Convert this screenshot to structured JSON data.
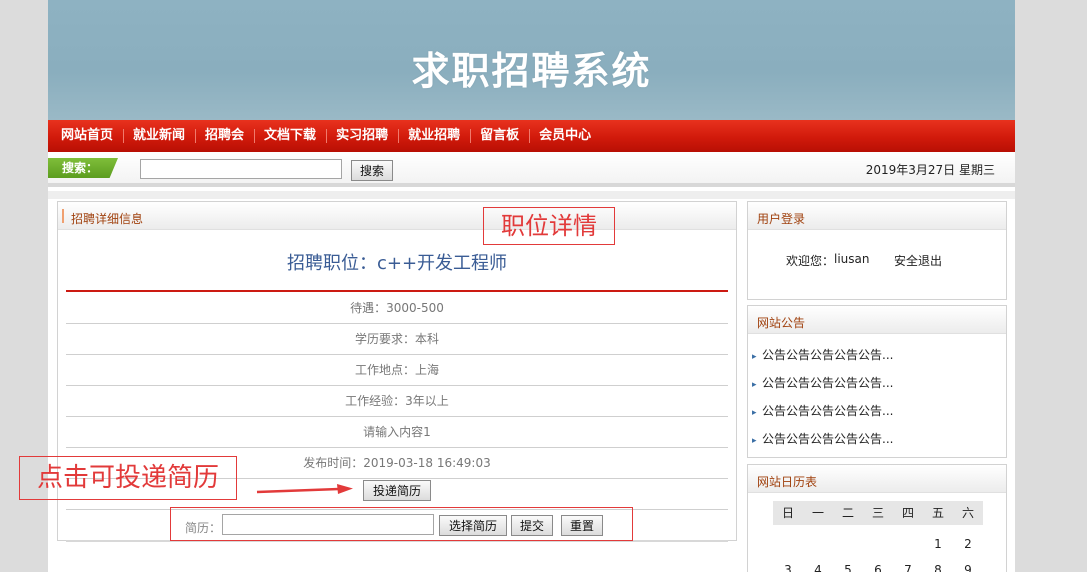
{
  "site": {
    "title": "求职招聘系统"
  },
  "nav": {
    "items": [
      "网站首页",
      "就业新闻",
      "招聘会",
      "文档下载",
      "实习招聘",
      "就业招聘",
      "留言板",
      "会员中心"
    ]
  },
  "search": {
    "label": "搜索：",
    "placeholder": "",
    "value": "",
    "button": "搜索"
  },
  "date": "2019年3月27日 星期三",
  "main": {
    "section_title": "招聘详细信息",
    "job_title": "招聘职位：c++开发工程师",
    "details": [
      "待遇：3000-500",
      "学历要求：本科",
      "工作地点：上海",
      "工作经验：3年以上",
      "请输入内容1",
      "发布时间：2019-03-18 16:49:03"
    ],
    "apply_button": "投递简历",
    "resume_label": "简历：",
    "resume_value": "",
    "choose_button": "选择简历",
    "submit_button": "提交",
    "reset_button": "重置"
  },
  "login": {
    "title": "用户登录",
    "welcome": "欢迎您：",
    "username": "liusan",
    "logout": "安全退出"
  },
  "notice": {
    "title": "网站公告",
    "items": [
      "公告公告公告公告公告...",
      "公告公告公告公告公告...",
      "公告公告公告公告公告...",
      "公告公告公告公告公告..."
    ]
  },
  "calendar": {
    "title": "网站日历表",
    "weekdays": [
      "日",
      "一",
      "二",
      "三",
      "四",
      "五",
      "六"
    ],
    "rows": [
      [
        "",
        "",
        "",
        "",
        "",
        "1",
        "2"
      ],
      [
        "3",
        "4",
        "5",
        "6",
        "7",
        "8",
        "9"
      ]
    ]
  },
  "annotations": {
    "detail": "职位详情",
    "click": "点击可投递简历",
    "color": "#e23a3a"
  }
}
